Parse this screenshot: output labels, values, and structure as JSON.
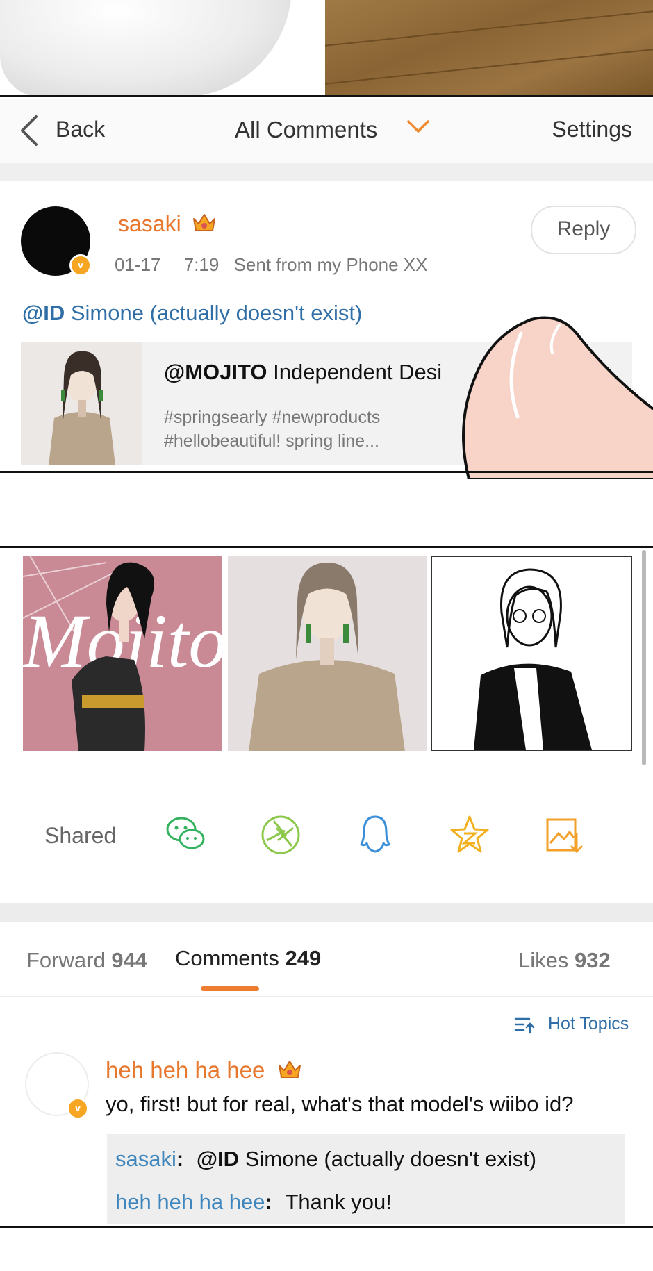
{
  "header": {
    "back_label": "Back",
    "title": "All Comments",
    "settings_label": "Settings"
  },
  "post": {
    "username": "sasaki",
    "date": "01-17",
    "time": "7:19",
    "source": "Sent from my Phone XX",
    "reply_label": "Reply",
    "mention_handle": "@ID",
    "mention_text": "Simone (actually doesn't exist)",
    "shared_card": {
      "title_handle": "@MOJITO",
      "title_text": "Independent Desi",
      "description": "#springsearly #newproducts #hellobeautiful! spring line..."
    },
    "tile1_text": "Mojito"
  },
  "share_bar": {
    "label": "Shared",
    "icons": [
      "wechat-icon",
      "moments-icon",
      "qq-icon",
      "qzone-icon",
      "save-image-icon"
    ]
  },
  "tabs": {
    "forward_label": "Forward",
    "forward_count": "944",
    "comments_label": "Comments",
    "comments_count": "249",
    "likes_label": "Likes",
    "likes_count": "932"
  },
  "sort": {
    "label": "Hot Topics"
  },
  "comment": {
    "username": "heh heh ha hee",
    "text": "yo, first! but for real, what's that model's wiibo id?",
    "replies": [
      {
        "name": "sasaki",
        "sep": ":",
        "handle": "@ID",
        "text": "Simone (actually doesn't exist)"
      },
      {
        "name": "heh heh ha hee",
        "sep": ":",
        "text": "Thank you!"
      }
    ]
  },
  "colors": {
    "accent_orange": "#ee7d2f",
    "link_blue": "#2f6ea6",
    "verified_badge": "#f6a623"
  }
}
